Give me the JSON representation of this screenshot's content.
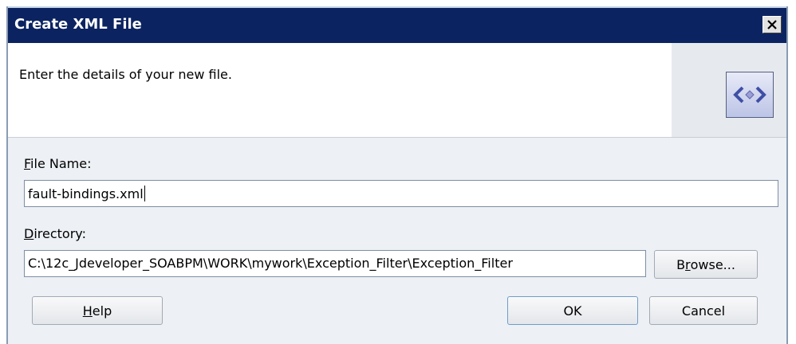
{
  "window": {
    "title": "Create XML File",
    "close_icon": "close-icon"
  },
  "header": {
    "description": "Enter the details of your new file.",
    "icon": "xml-file-icon"
  },
  "form": {
    "file_name": {
      "label_mnemonic": "F",
      "label_rest": "ile Name:",
      "value": "fault-bindings.xml"
    },
    "directory": {
      "label_mnemonic": "D",
      "label_rest": "irectory:",
      "value": "C:\\12c_Jdeveloper_SOABPM\\WORK\\mywork\\Exception_Filter\\Exception_Filter"
    }
  },
  "buttons": {
    "browse": {
      "pre": "B",
      "mnemonic": "r",
      "post": "owse..."
    },
    "help": {
      "pre": "",
      "mnemonic": "H",
      "post": "elp"
    },
    "ok": "OK",
    "cancel": "Cancel"
  }
}
